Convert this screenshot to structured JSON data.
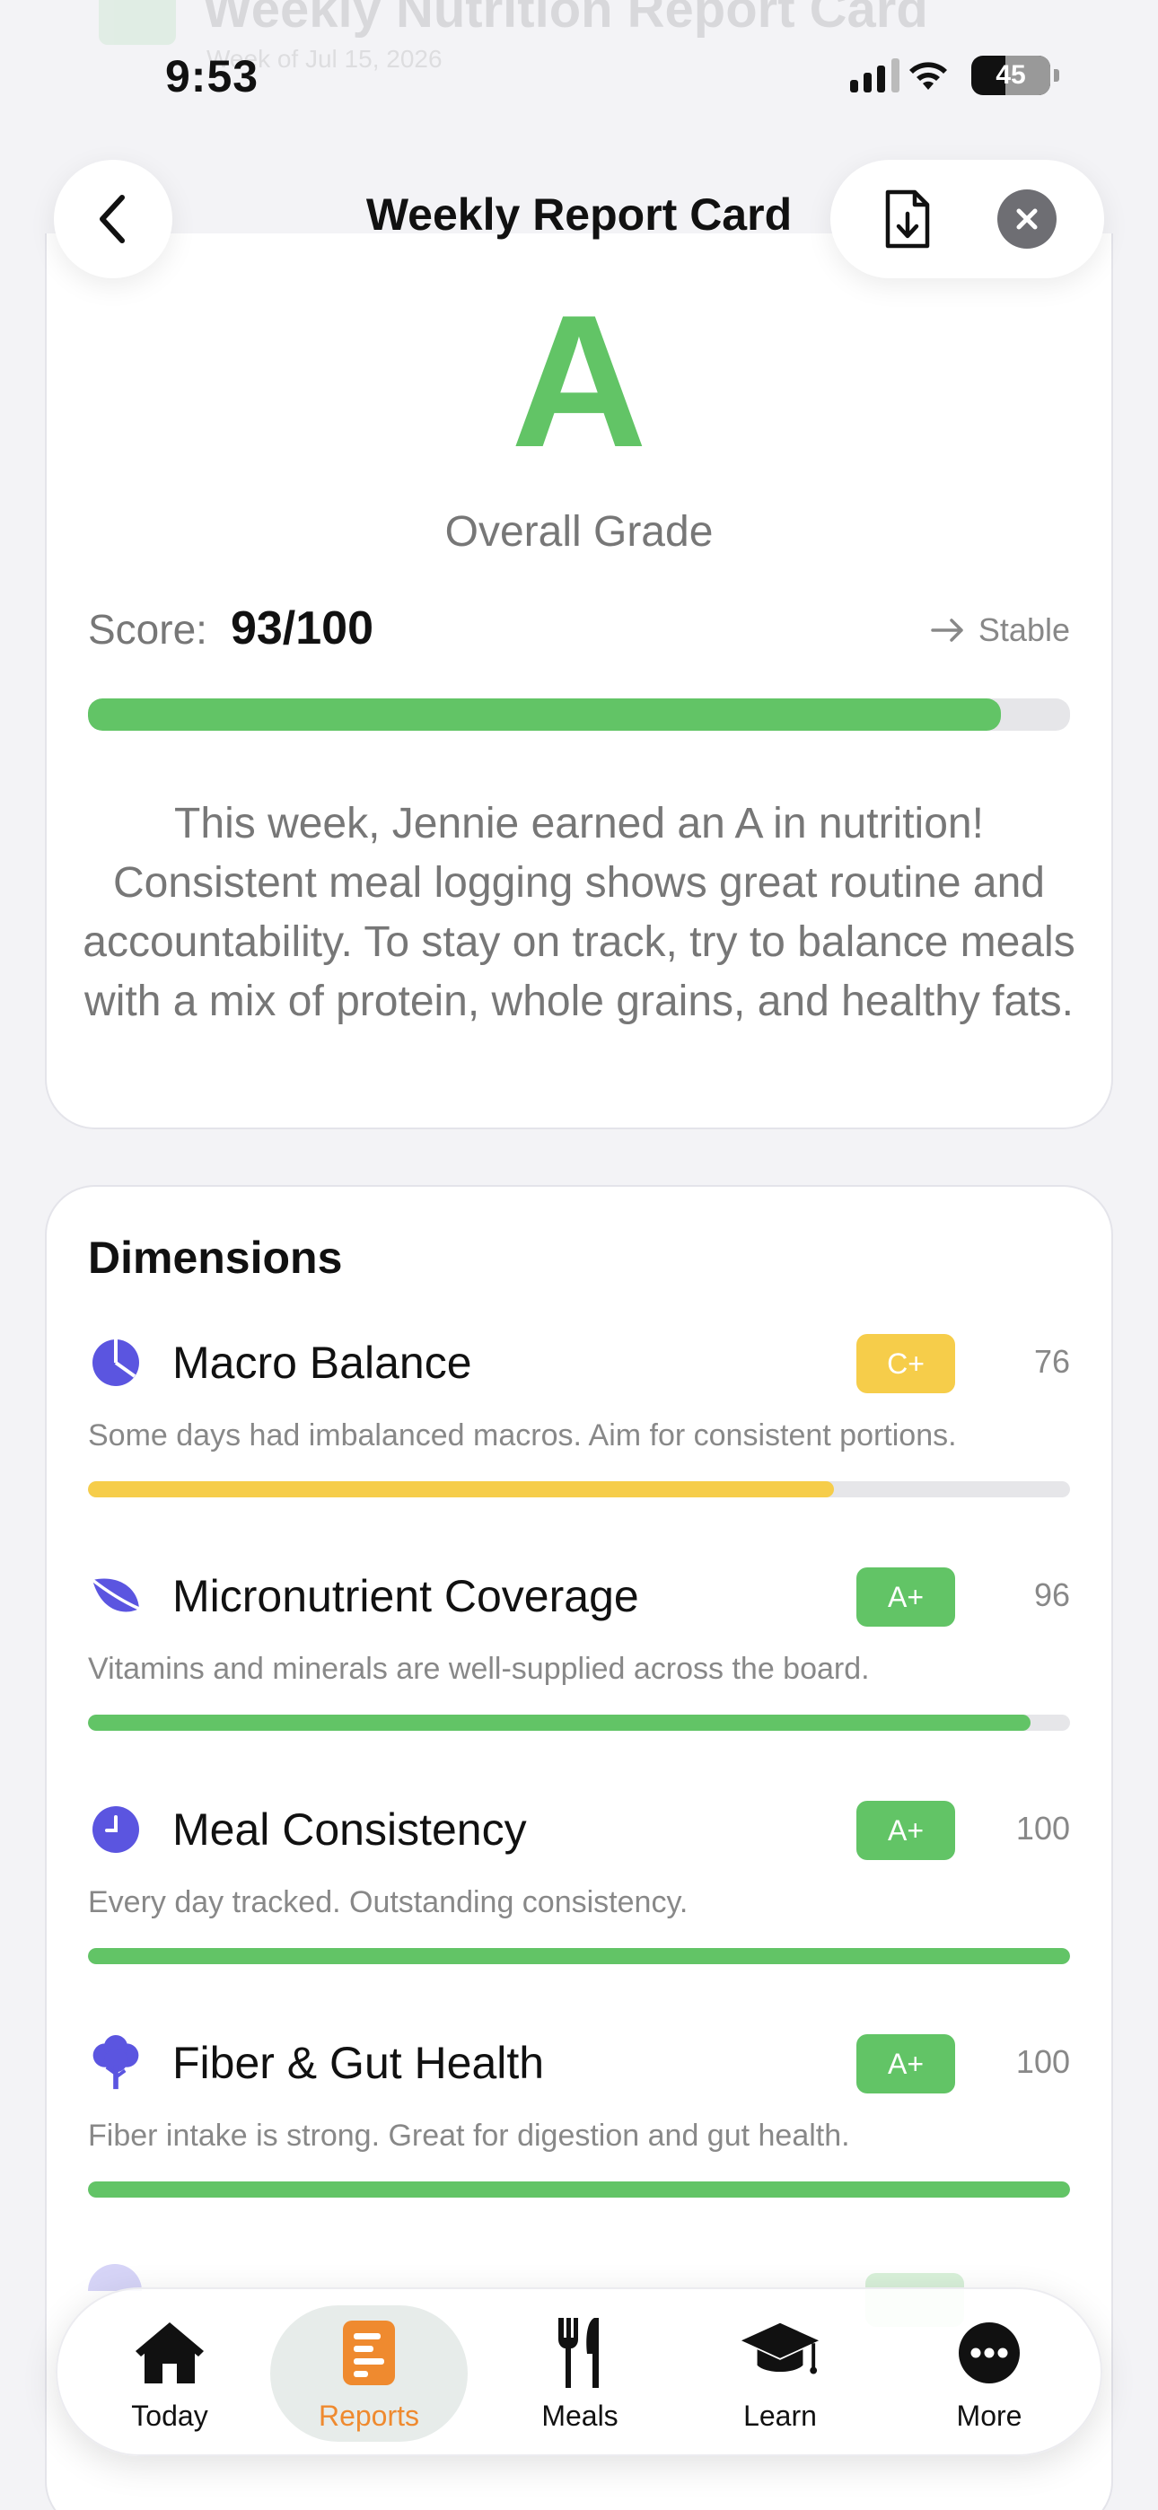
{
  "background": {
    "title": "Weekly Nutrition Report Card",
    "subtitle": "Week of Jul 15, 2026"
  },
  "status_bar": {
    "time": "9:53",
    "battery": "45"
  },
  "header": {
    "title": "Weekly Report Card",
    "back_icon": "chevron-left-icon",
    "download_icon": "download-document-icon",
    "close_icon": "close-icon"
  },
  "overall": {
    "grade": "A",
    "grade_caption": "Overall Grade",
    "score_label": "Score:",
    "score_value": "93/100",
    "score_fraction": 0.93,
    "trend_label": "Stable",
    "summary": "This week, Jennie earned an A in nutrition! Consistent meal logging shows great routine and accountability. To stay on track, try to balance meals with a mix of protein, whole grains, and healthy fats.",
    "accent_color": "#62c466"
  },
  "dimensions": {
    "title": "Dimensions",
    "items": [
      {
        "name": "Macro Balance",
        "icon": "pie-chart-icon",
        "grade": "C+",
        "score": "76",
        "fraction": 0.76,
        "color": "#f6cd4a",
        "description": "Some days had imbalanced macros. Aim for consistent portions."
      },
      {
        "name": "Micronutrient Coverage",
        "icon": "leaf-icon",
        "grade": "A+",
        "score": "96",
        "fraction": 0.96,
        "color": "#62c466",
        "description": "Vitamins and minerals are well-supplied across the board."
      },
      {
        "name": "Meal Consistency",
        "icon": "clock-icon",
        "grade": "A+",
        "score": "100",
        "fraction": 1.0,
        "color": "#62c466",
        "description": "Every day tracked. Outstanding consistency."
      },
      {
        "name": "Fiber & Gut Health",
        "icon": "tree-icon",
        "grade": "A+",
        "score": "100",
        "fraction": 1.0,
        "color": "#62c466",
        "description": "Fiber intake is strong. Great for digestion and gut health."
      }
    ]
  },
  "tabs": [
    {
      "label": "Today",
      "icon": "home-icon",
      "active": false
    },
    {
      "label": "Reports",
      "icon": "report-icon",
      "active": true
    },
    {
      "label": "Meals",
      "icon": "fork-knife-icon",
      "active": false
    },
    {
      "label": "Learn",
      "icon": "graduation-cap-icon",
      "active": false
    },
    {
      "label": "More",
      "icon": "more-icon",
      "active": false
    }
  ],
  "colors": {
    "green": "#62c466",
    "yellow": "#f6cd4a",
    "purple": "#5b55e0",
    "orange": "#ef8a2f"
  }
}
